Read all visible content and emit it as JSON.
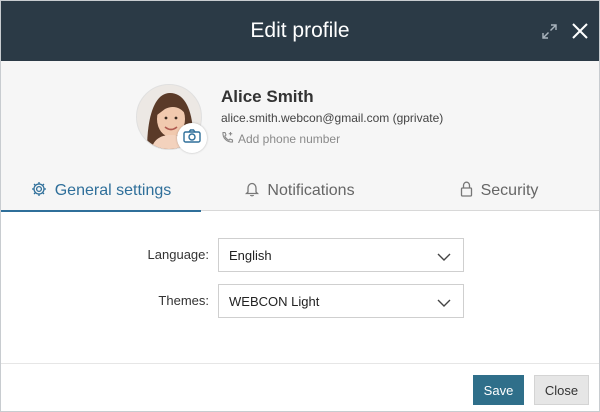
{
  "dialog": {
    "title": "Edit profile"
  },
  "profile": {
    "name": "Alice Smith",
    "email": "alice.smith.webcon@gmail.com (gprivate)",
    "add_phone": "Add phone number"
  },
  "tabs": [
    {
      "label": "General settings",
      "icon": "gear-icon",
      "active": true
    },
    {
      "label": "Notifications",
      "icon": "bell-icon",
      "active": false
    },
    {
      "label": "Security",
      "icon": "lock-icon",
      "active": false
    }
  ],
  "settings": {
    "language": {
      "label": "Language:",
      "value": "English"
    },
    "themes": {
      "label": "Themes:",
      "value": "WEBCON Light"
    }
  },
  "footer": {
    "save_label": "Save",
    "close_label": "Close"
  },
  "colors": {
    "titlebar": "#2b3a46",
    "accent": "#2f6f9a",
    "save_button": "#2f6f8a"
  }
}
